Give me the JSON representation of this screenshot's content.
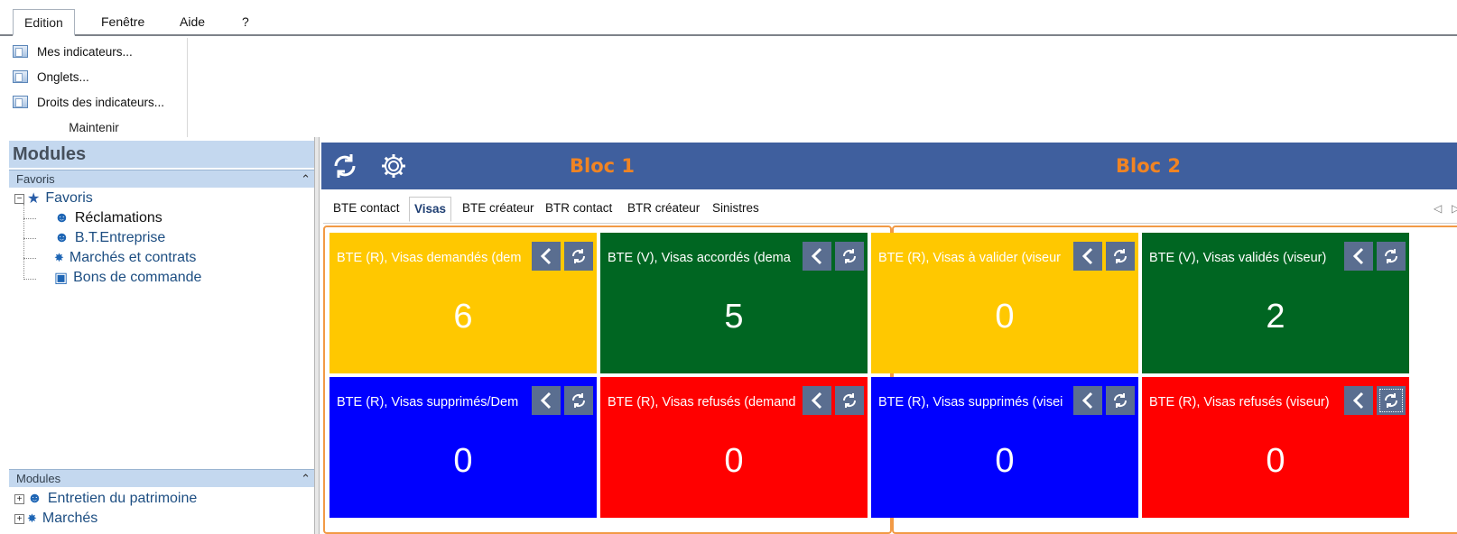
{
  "menubar": {
    "items": [
      {
        "label": "Edition",
        "active": true
      },
      {
        "label": "Fenêtre",
        "active": false
      },
      {
        "label": "Aide",
        "active": false
      },
      {
        "label": "?",
        "active": false
      }
    ]
  },
  "ribbon": {
    "buttons": [
      {
        "label": "Mes indicateurs...",
        "icon": "window-icon"
      },
      {
        "label": "Onglets...",
        "icon": "window-icon"
      },
      {
        "label": "Droits des indicateurs...",
        "icon": "window-icon"
      }
    ],
    "group_label": "Maintenir"
  },
  "left_panel": {
    "title": "Modules",
    "favoris_section": {
      "label": "Favoris",
      "root": "Favoris",
      "items": [
        {
          "label": "Réclamations",
          "icon": "person-icon"
        },
        {
          "label": "B.T.Entreprise",
          "icon": "person-icon"
        },
        {
          "label": "Marchés et contrats",
          "icon": "handshake-icon"
        },
        {
          "label": "Bons de commande",
          "icon": "cart-icon"
        }
      ]
    },
    "modules_section": {
      "label": "Modules",
      "items": [
        {
          "label": "Entretien du patrimoine",
          "icon": "person-icon"
        },
        {
          "label": "Marchés",
          "icon": "handshake-icon"
        }
      ]
    }
  },
  "main": {
    "bloc1_title": "Bloc 1",
    "bloc2_title": "Bloc 2",
    "tabs": [
      {
        "label": "BTE contact",
        "active": false
      },
      {
        "label": "Visas",
        "active": true
      },
      {
        "label": "BTE créateur",
        "active": false
      },
      {
        "label": "BTR contact",
        "active": false
      },
      {
        "label": "BTR créateur",
        "active": false
      },
      {
        "label": "Sinistres",
        "active": false
      }
    ],
    "tiles": [
      {
        "title": "BTE (R), Visas demandés (dem",
        "value": "6",
        "color": "#ffc800",
        "text_color": "#ffffff"
      },
      {
        "title": "BTE (V), Visas accordés (dema",
        "value": "5",
        "color": "#006622",
        "text_color": "#ffffff"
      },
      {
        "title": "BTE (R), Visas à valider (viseur",
        "value": "0",
        "color": "#ffc800",
        "text_color": "#ffffff"
      },
      {
        "title": "BTE (V), Visas validés (viseur)",
        "value": "2",
        "color": "#006622",
        "text_color": "#ffffff"
      },
      {
        "title": "BTE (R), Visas supprimés/Dem",
        "value": "0",
        "color": "#0000ff",
        "text_color": "#ffffff"
      },
      {
        "title": "BTE (R), Visas refusés (demand",
        "value": "0",
        "color": "#ff0000",
        "text_color": "#ffffff"
      },
      {
        "title": "BTE (R), Visas supprimés (visei",
        "value": "0",
        "color": "#0000ff",
        "text_color": "#ffffff"
      },
      {
        "title": "BTE (R), Visas refusés (viseur)",
        "value": "0",
        "color": "#ff0000",
        "text_color": "#ffffff"
      }
    ]
  },
  "colors": {
    "header_bar": "#3f5f9e",
    "bloc_accent": "#f08423",
    "panel_header": "#c4d8ef",
    "tile_button": "#5a6e90"
  }
}
